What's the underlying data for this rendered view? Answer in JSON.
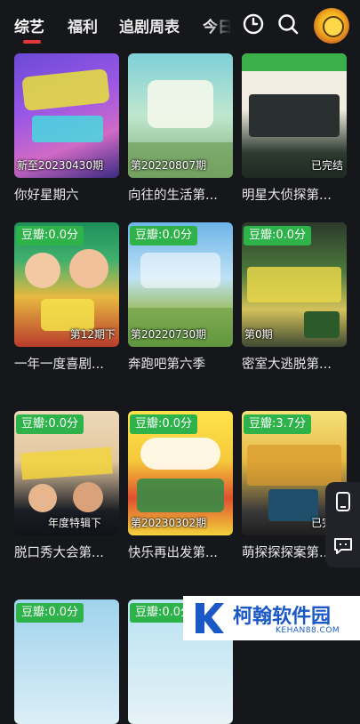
{
  "tabs": [
    {
      "label": "综艺",
      "active": true
    },
    {
      "label": "福利",
      "active": false
    },
    {
      "label": "追剧周表",
      "active": false
    },
    {
      "label": "今日",
      "active": false
    }
  ],
  "header_icons": [
    "history-icon",
    "search-icon",
    "avatar"
  ],
  "cards": [
    {
      "title": "你好星期六",
      "badge": "",
      "episode": "新至20230430期",
      "art": "p1"
    },
    {
      "title": "向往的生活第...",
      "badge": "",
      "episode": "第20220807期",
      "art": "p2"
    },
    {
      "title": "明星大侦探第...",
      "badge": "",
      "episode": "已完结",
      "art": "p3"
    },
    {
      "title": "一年一度喜剧...",
      "badge": "豆瓣:0.0分",
      "episode": "第12期下",
      "art": "p4"
    },
    {
      "title": "奔跑吧第六季",
      "badge": "豆瓣:0.0分",
      "episode": "第20220730期",
      "art": "p5"
    },
    {
      "title": "密室大逃脱第...",
      "badge": "豆瓣:0.0分",
      "episode": "第0期",
      "art": "p6"
    },
    {
      "title": "脱口秀大会第...",
      "badge": "豆瓣:0.0分",
      "episode": "年度特辑下",
      "art": "p7"
    },
    {
      "title": "快乐再出发第...",
      "badge": "豆瓣:0.0分",
      "episode": "第20230302期",
      "art": "p8"
    },
    {
      "title": "萌探探探案第...",
      "badge": "豆瓣:3.7分",
      "episode": "已完结",
      "art": "p9"
    },
    {
      "title": "",
      "badge": "豆瓣:0.0分",
      "episode": "",
      "art": "p10"
    },
    {
      "title": "",
      "badge": "豆瓣:0.0分",
      "episode": "",
      "art": "p11"
    }
  ],
  "float_buttons": [
    "phone-icon",
    "message-icon"
  ],
  "watermark": {
    "name": "柯翰软件园",
    "url": "KEHAN88.COM"
  },
  "colors": {
    "background": "#16171b",
    "accent": "#e5343a",
    "badge": "#2db34a"
  }
}
